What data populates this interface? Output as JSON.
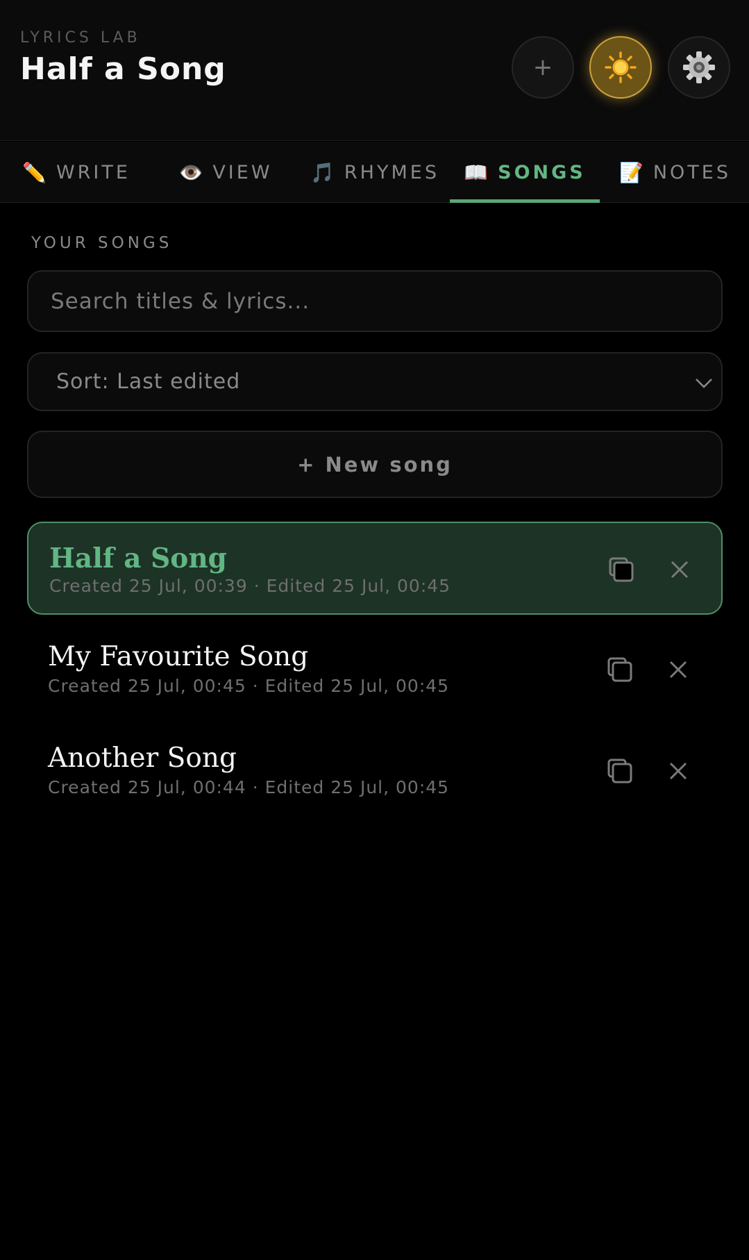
{
  "header": {
    "app_label": "LYRICS LAB",
    "title": "Half a Song",
    "add_icon": "plus-icon",
    "theme_icon": "sun-icon",
    "settings_icon": "gear-icon",
    "accent_color": "#caa13f"
  },
  "tabs": [
    {
      "emoji": "✏️",
      "label": "WRITE",
      "icon": "pencil-icon"
    },
    {
      "emoji": "👁️",
      "label": "VIEW",
      "icon": "eye-icon"
    },
    {
      "emoji": "🎵",
      "label": "RHYMES",
      "icon": "music-note-icon"
    },
    {
      "emoji": "📖",
      "label": "SONGS",
      "icon": "book-icon",
      "active": true
    },
    {
      "emoji": "📝",
      "label": "NOTES",
      "icon": "memo-icon"
    }
  ],
  "songs_panel": {
    "section_label": "YOUR SONGS",
    "search_placeholder": "Search titles & lyrics...",
    "sort_value": "Sort: Last edited",
    "new_song_label": "+ New song"
  },
  "songs": [
    {
      "title": "Half a Song",
      "meta": "Created 25 Jul, 00:39 · Edited 25 Jul, 00:45",
      "active": true
    },
    {
      "title": "My Favourite Song",
      "meta": "Created 25 Jul, 00:45 · Edited 25 Jul, 00:45"
    },
    {
      "title": "Another Song",
      "meta": "Created 25 Jul, 00:44 · Edited 25 Jul, 00:45"
    }
  ],
  "colors": {
    "active_green": "#62b684",
    "active_bg": "#1d3326",
    "background": "#000000"
  }
}
